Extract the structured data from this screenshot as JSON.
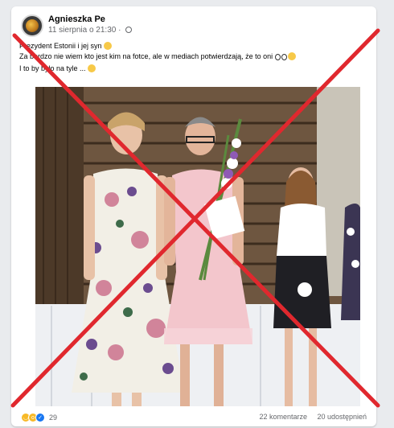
{
  "post": {
    "author": "Agnieszka Pe",
    "timestamp": "11 sierpnia o 21:30",
    "privacy_icon": "globe-icon",
    "lines": [
      "Prezydent Estonii i jej syn",
      "Za bardzo nie wiem kto jest kim na fotce, ale w mediach potwierdzają, że to oni",
      "I to by było na tyle ..."
    ]
  },
  "photo": {
    "description_icon": "photo",
    "overlay": "red-x-mark"
  },
  "footer": {
    "reaction_icons": [
      "haha-icon",
      "wow-icon",
      "like-icon"
    ],
    "reaction_count": "29",
    "comments": "22 komentarze",
    "shares": "20 udostępnień"
  },
  "colors": {
    "x_mark": "#e0282e",
    "link_gray": "#65676b",
    "card_bg": "#ffffff",
    "page_bg": "#e9ebee"
  }
}
